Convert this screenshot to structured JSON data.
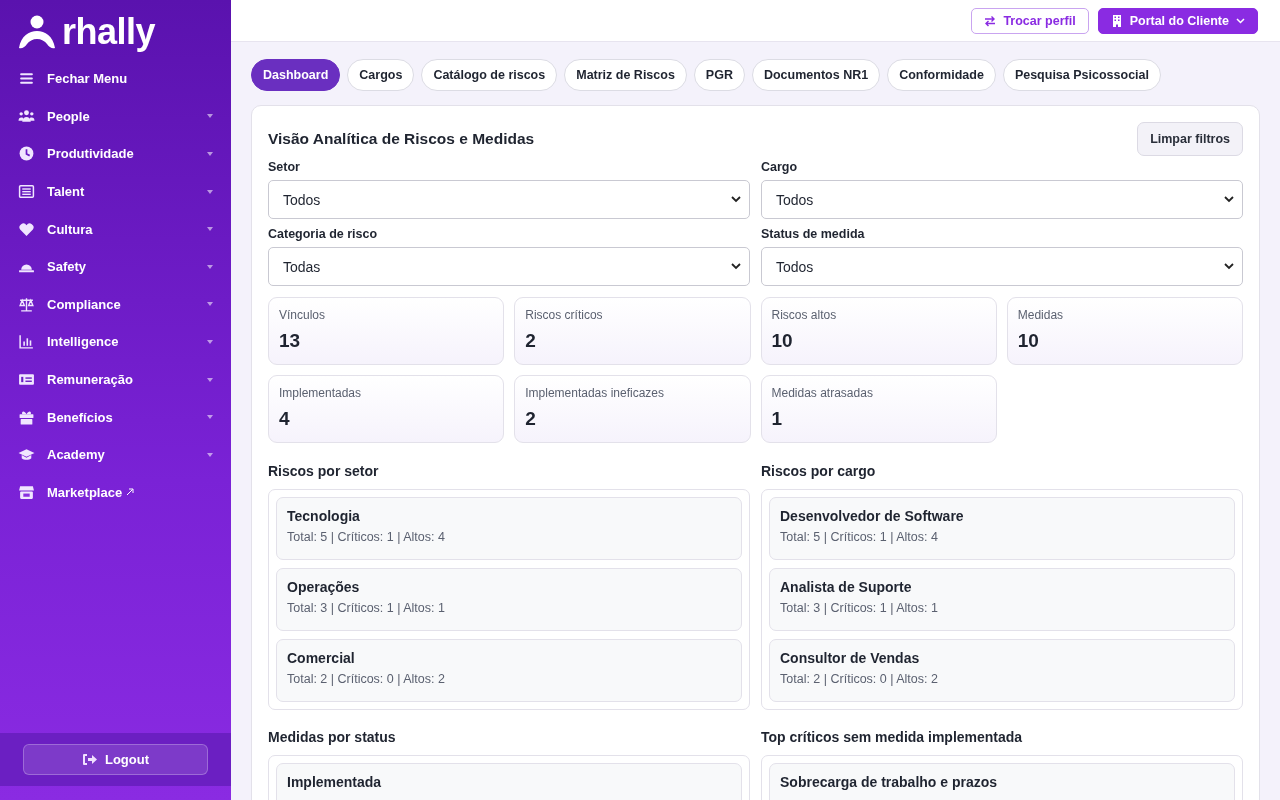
{
  "sidebar": {
    "logo": "rhally",
    "items": [
      {
        "label": "Fechar Menu",
        "kind": "toggle"
      },
      {
        "label": "People",
        "kind": "menu"
      },
      {
        "label": "Produtividade",
        "kind": "menu"
      },
      {
        "label": "Talent",
        "kind": "menu"
      },
      {
        "label": "Cultura",
        "kind": "menu"
      },
      {
        "label": "Safety",
        "kind": "menu"
      },
      {
        "label": "Compliance",
        "kind": "menu"
      },
      {
        "label": "Intelligence",
        "kind": "menu"
      },
      {
        "label": "Remuneração",
        "kind": "menu"
      },
      {
        "label": "Benefícios",
        "kind": "menu"
      },
      {
        "label": "Academy",
        "kind": "menu"
      },
      {
        "label": "Marketplace",
        "kind": "link"
      }
    ],
    "logout": "Logout"
  },
  "header": {
    "buttons": [
      {
        "label": "Trocar perfil",
        "kind": "outline"
      },
      {
        "label": "Portal do Cliente",
        "kind": "primary"
      }
    ]
  },
  "tabs": [
    {
      "label": "Dashboard",
      "selected": true
    },
    {
      "label": "Cargos",
      "selected": false
    },
    {
      "label": "Catálogo de riscos",
      "selected": false
    },
    {
      "label": "Matriz de Riscos",
      "selected": false
    },
    {
      "label": "PGR",
      "selected": false
    },
    {
      "label": "Documentos NR1",
      "selected": false
    },
    {
      "label": "Conformidade",
      "selected": false
    },
    {
      "label": "Pesquisa Psicossocial",
      "selected": false
    }
  ],
  "panel": {
    "title": "Visão Analítica de Riscos e Medidas",
    "clear_button": "Limpar filtros",
    "filters": [
      {
        "label": "Setor",
        "value": "Todos"
      },
      {
        "label": "Cargo",
        "value": "Todos"
      },
      {
        "label": "Categoria de risco",
        "value": "Todas"
      },
      {
        "label": "Status de medida",
        "value": "Todos"
      }
    ],
    "stats": [
      {
        "label": "Vínculos",
        "value": "13"
      },
      {
        "label": "Riscos críticos",
        "value": "2"
      },
      {
        "label": "Riscos altos",
        "value": "10"
      },
      {
        "label": "Medidas",
        "value": "10"
      },
      {
        "label": "Implementadas",
        "value": "4"
      },
      {
        "label": "Implementadas ineficazes",
        "value": "2"
      },
      {
        "label": "Medidas atrasadas",
        "value": "1"
      }
    ],
    "sections": [
      {
        "title": "Riscos por setor",
        "items": [
          {
            "name": "Tecnologia",
            "detail": "Total: 5 | Críticos: 1 | Altos: 4"
          },
          {
            "name": "Operações",
            "detail": "Total: 3 | Críticos: 1 | Altos: 1"
          },
          {
            "name": "Comercial",
            "detail": "Total: 2 | Críticos: 0 | Altos: 2"
          }
        ]
      },
      {
        "title": "Riscos por cargo",
        "items": [
          {
            "name": "Desenvolvedor de Software",
            "detail": "Total: 5 | Críticos: 1 | Altos: 4"
          },
          {
            "name": "Analista de Suporte",
            "detail": "Total: 3 | Críticos: 1 | Altos: 1"
          },
          {
            "name": "Consultor de Vendas",
            "detail": "Total: 2 | Críticos: 0 | Altos: 2"
          }
        ]
      },
      {
        "title": "Medidas por status",
        "items": [
          {
            "name": "Implementada"
          }
        ]
      },
      {
        "title": "Top críticos sem medida implementada",
        "items": [
          {
            "name": "Sobrecarga de trabalho e prazos"
          }
        ]
      }
    ]
  }
}
